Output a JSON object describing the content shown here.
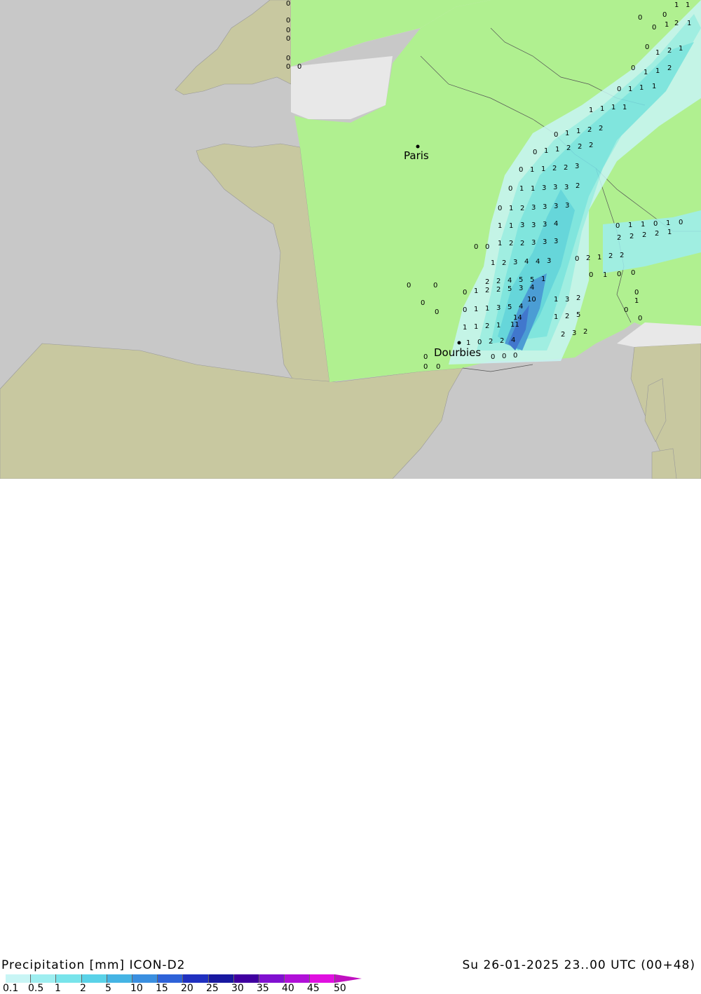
{
  "map": {
    "cities": [
      {
        "name": "Paris"
      },
      {
        "name": "Dourbies"
      }
    ],
    "colors": {
      "sea": "#c8c8c8",
      "land_outside": "#c8c8a0",
      "model_domain_land": "#b0f090",
      "water_in_domain": "#e8e8e8"
    }
  },
  "footer": {
    "title": "Precipitation [mm] ICON-D2",
    "datetime": "Su 26-01-2025 23..00 UTC (00+48)"
  },
  "legend": {
    "ticks": [
      "0.1",
      "0.5",
      "1",
      "2",
      "5",
      "10",
      "15",
      "20",
      "25",
      "30",
      "35",
      "40",
      "45",
      "50"
    ],
    "colors": [
      "#c8f5f5",
      "#9eeef0",
      "#78e4eb",
      "#5ad2e8",
      "#45b4e4",
      "#3a8fe0",
      "#2e62d8",
      "#2030c0",
      "#1818a0",
      "#4000a0",
      "#8010d0",
      "#b010d8",
      "#e010e0",
      "#c010c0"
    ]
  }
}
